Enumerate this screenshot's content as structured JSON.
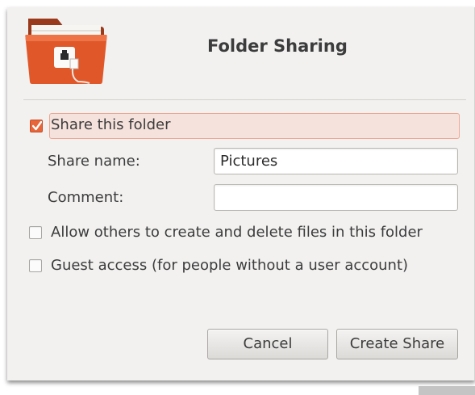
{
  "dialog": {
    "title": "Folder Sharing",
    "icon": "folder-share-icon"
  },
  "share": {
    "label": "Share this folder",
    "checked": true
  },
  "fields": {
    "share_name_label": "Share name:",
    "share_name_value": "Pictures",
    "comment_label": "Comment:",
    "comment_value": ""
  },
  "options": {
    "allow_others_label": "Allow others to create and delete files in this folder",
    "allow_others_checked": false,
    "guest_access_label": "Guest access (for people without a user account)",
    "guest_access_checked": false
  },
  "buttons": {
    "cancel_label": "Cancel",
    "create_label": "Create Share"
  },
  "colors": {
    "accent": "#e7653a",
    "folder": "#e0582a",
    "highlight_bg": "#f6e2dc"
  }
}
